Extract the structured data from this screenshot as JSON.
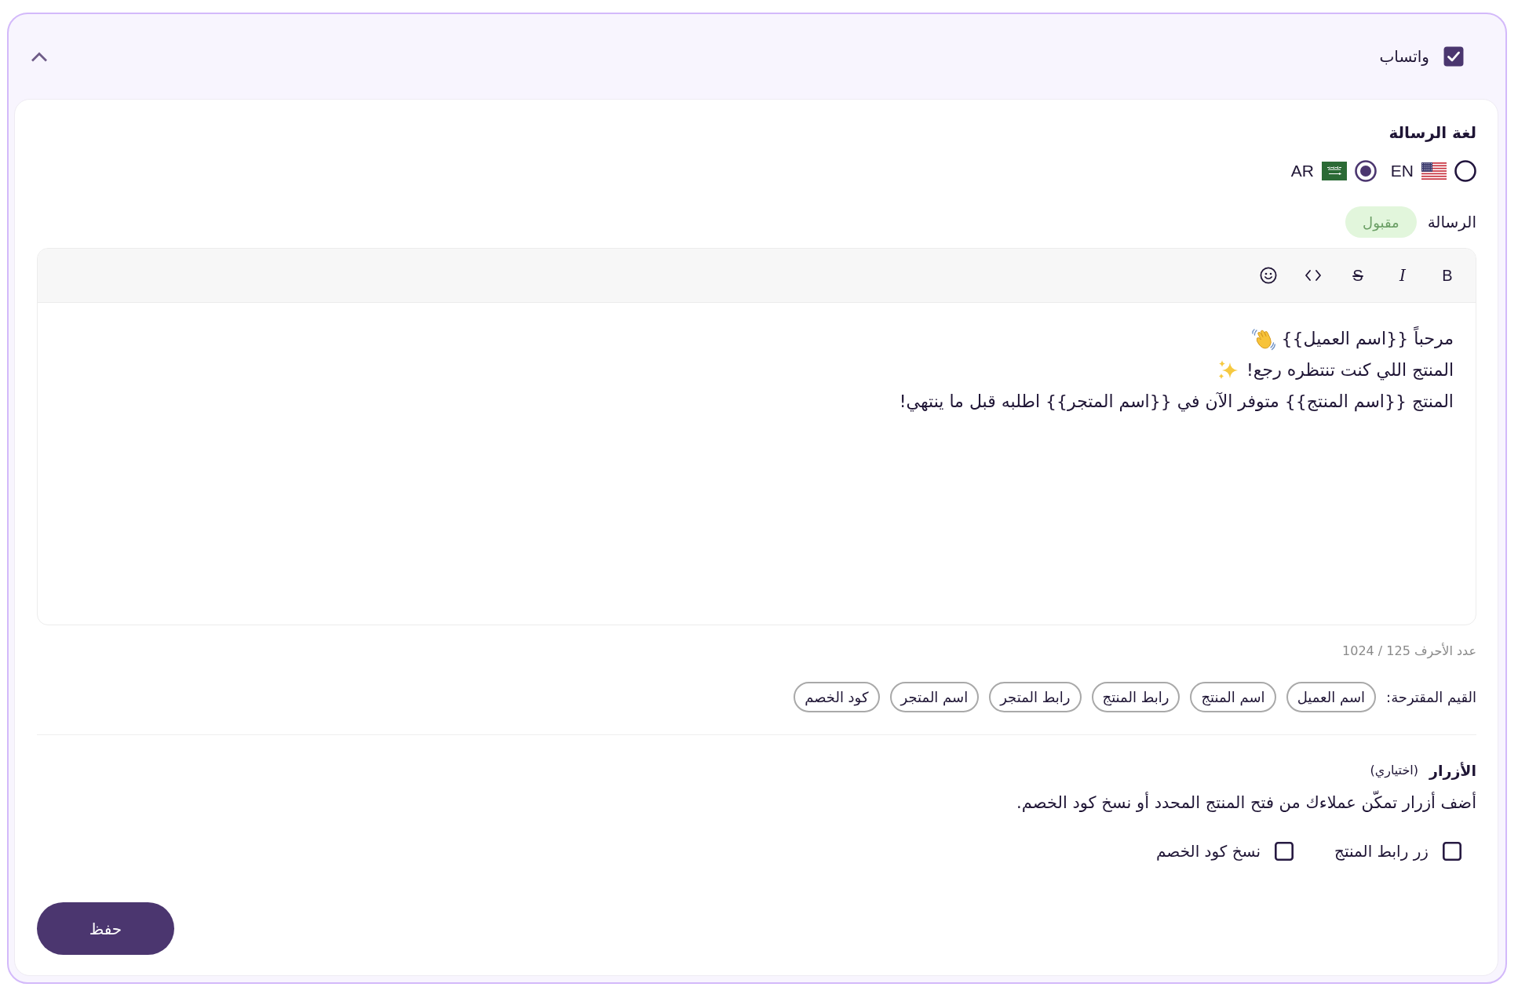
{
  "channel": {
    "label": "واتساب",
    "checked": true,
    "expanded": true
  },
  "language": {
    "title": "لغة الرسالة",
    "options": [
      {
        "label": "EN",
        "selected": false
      },
      {
        "label": "AR",
        "selected": true
      }
    ]
  },
  "message": {
    "label": "الرسالة",
    "status": "مقبول",
    "toolbar": [
      {
        "kind": "bold",
        "label": "B"
      },
      {
        "kind": "italic",
        "label": "I"
      },
      {
        "kind": "strike",
        "label": "S"
      },
      {
        "kind": "code"
      },
      {
        "kind": "emoji"
      }
    ],
    "lines": [
      {
        "kind": "wave",
        "text": "مرحباً {{اسم العميل}}"
      },
      {
        "kind": "sparkle",
        "text": "المنتج اللي كنت تنتظره رجع!"
      },
      {
        "kind": "plain",
        "text": "المنتج {{اسم المنتج}} متوفر الآن في {{اسم المتجر}} اطلبه قبل ما ينتهي!"
      }
    ],
    "char_count": "عدد الأحرف 125 / 1024"
  },
  "suggestions": {
    "label": "القيم المقترحة:",
    "chips": [
      "اسم العميل",
      "اسم المنتج",
      "رابط المنتج",
      "رابط المتجر",
      "اسم المتجر",
      "كود الخصم"
    ]
  },
  "buttons_section": {
    "title": "الأزرار",
    "hint": "(اختياري)",
    "description": "أضف أزرار تمكّن عملاءك من فتح المنتج المحدد أو نسخ كود الخصم.",
    "options": [
      {
        "label": "زر رابط المنتج",
        "checked": false
      },
      {
        "label": "نسخ كود الخصم",
        "checked": false
      }
    ]
  },
  "save_button": "حفظ"
}
